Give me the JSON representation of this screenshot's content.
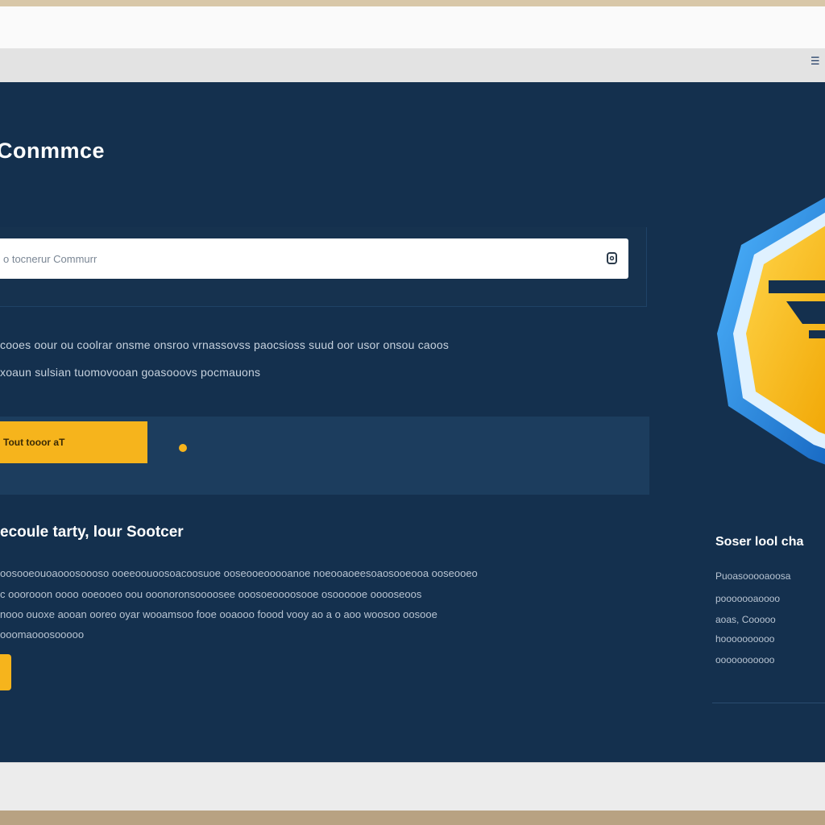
{
  "header": {
    "title": "Conmmce"
  },
  "search": {
    "placeholder": "o tocnerur Commurr"
  },
  "hero": {
    "line1": "cooes oour ou coolrar onsme onsroo vrnassovss paocsioss suud oor usor onsou caoos",
    "line2": "xoaun sulsian tuomovooan goasooovs pocmauons"
  },
  "promo": {
    "cta_label": "Tout tooor aT"
  },
  "section": {
    "heading": "ecoule tarty, lour Sootcer",
    "lines": [
      "oosooeouoaooosoooso ooeeoouoosoacoosuoe ooseooeooooanoe noeooaoeesoaosooeooa ooseooeo",
      "c ooorooon oooo ooeooeo oou ooonoronsoooosee ooosoeoooosooe osoooooe ooooseoos",
      "nooo ouoxe aooan ooreo oyar wooamsoo fooe ooaooo foood vooy ao a o aoo woosoo oosooe",
      "ooomaooosooooo"
    ]
  },
  "sidebar": {
    "heading": "Soser lool cha",
    "lines": [
      "Puoasooooaoosa",
      "pooooooaoooo",
      "aoas, Cooooo",
      "hoooooooooo",
      "ooooooooooo"
    ]
  },
  "colors": {
    "background": "#14304e",
    "accent": "#f6b41c",
    "panel": "#1c3d5e",
    "text": "#ffffff"
  },
  "icons": {
    "search": "search-icon",
    "logo": "shopping-cart-shield-logo"
  }
}
